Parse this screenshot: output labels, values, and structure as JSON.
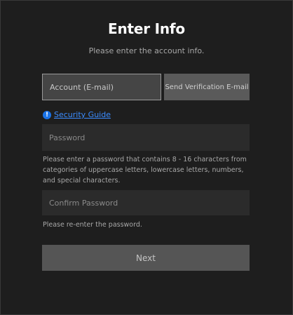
{
  "header": {
    "title": "Enter Info",
    "subtitle": "Please enter the account info."
  },
  "account": {
    "placeholder": "Account (E-mail)",
    "send_button_label": "Send Verification E-mail"
  },
  "security_guide": {
    "icon": "info-icon",
    "icon_glyph": "!",
    "link_text": "Security Guide"
  },
  "password": {
    "placeholder": "Password",
    "hint": "Please enter a password that contains 8 - 16 characters from categories of uppercase letters, lowercase letters, numbers, and special characters."
  },
  "confirm_password": {
    "placeholder": "Confirm Password",
    "hint": "Please re-enter the password."
  },
  "actions": {
    "next_label": "Next"
  },
  "colors": {
    "background": "#1e1e1e",
    "field_background": "#2b2b2b",
    "link": "#3b8cff",
    "info_icon": "#1a73e8",
    "button_background": "#555555"
  }
}
